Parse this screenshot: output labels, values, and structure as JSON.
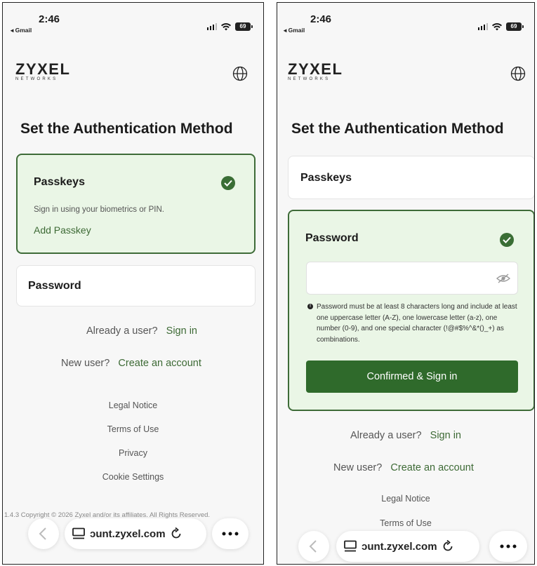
{
  "status_bar": {
    "time": "2:46",
    "back_app": "◂ Gmail",
    "battery": "69"
  },
  "brand": {
    "logo_word": "ZYXEL",
    "logo_sub": "NETWORKS",
    "globe_icon": "globe-icon"
  },
  "page": {
    "title": "Set the Authentication Method"
  },
  "passkeys": {
    "title": "Passkeys",
    "description": "Sign in using your biometrics or PIN.",
    "add_link": "Add Passkey"
  },
  "password": {
    "title": "Password",
    "input_value": "",
    "hint": "Password must be at least 8 characters long and include at least one uppercase letter (A-Z), one lowercase letter (a-z), one number (0-9), and one special character (!@#$%^&*()_+) as combinations.",
    "confirm_button": "Confirmed & Sign in"
  },
  "auth_links": {
    "already_user": "Already a user?",
    "sign_in": "Sign in",
    "new_user": "New user?",
    "create_account": "Create an account"
  },
  "footer": {
    "legal": "Legal Notice",
    "terms": "Terms of Use",
    "privacy": "Privacy",
    "cookies": "Cookie Settings",
    "copyright": "1.4.3 Copyright © 2026 Zyxel and/or its affiliates. All Rights Reserved."
  },
  "browser": {
    "url": "ɔunt.zyxel.com"
  },
  "colors": {
    "accent": "#3d6a35",
    "active_card_bg": "#eaf6e6",
    "button": "#2f6a2b"
  }
}
